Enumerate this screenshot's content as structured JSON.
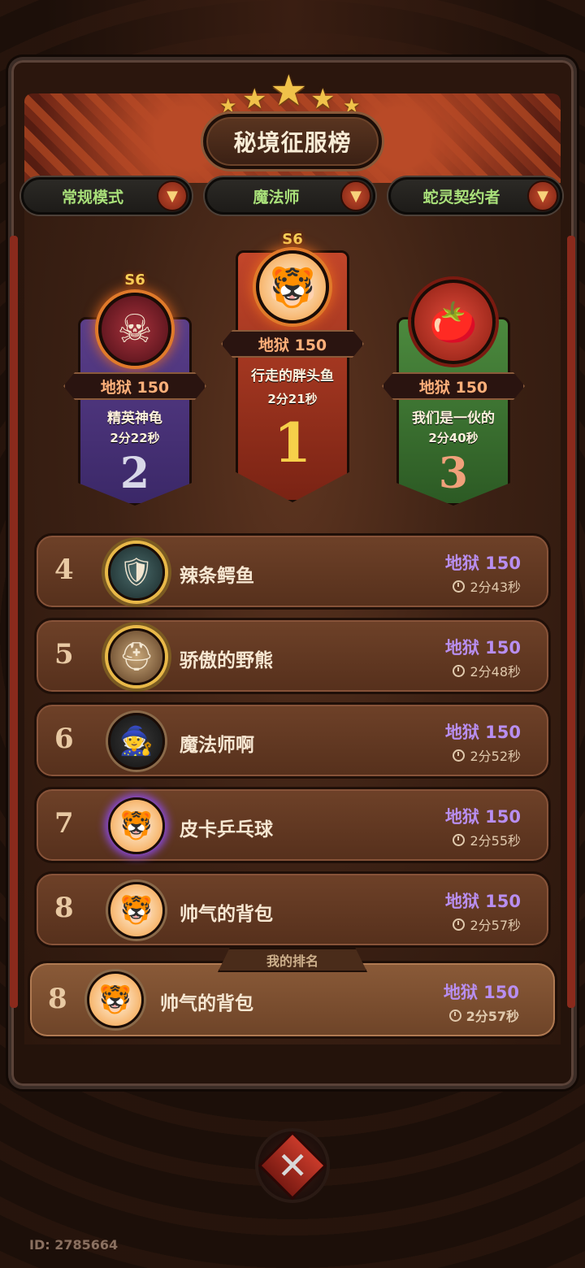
{
  "title": "秘境征服榜",
  "filters": [
    {
      "label": "常规模式"
    },
    {
      "label": "魔法师"
    },
    {
      "label": "蛇灵契约者"
    }
  ],
  "podium": [
    {
      "rank": "2",
      "season": "S6",
      "difficulty": "地狱 150",
      "name": "精英神龟",
      "time": "2分22秒",
      "avatar_icon": "demon-avatar-icon",
      "card_color": "#5a3e8a"
    },
    {
      "rank": "1",
      "season": "S6",
      "difficulty": "地狱 150",
      "name": "行走的胖头鱼",
      "time": "2分21秒",
      "avatar_icon": "tiger-avatar-icon",
      "card_color": "#c2462a"
    },
    {
      "rank": "3",
      "season": "",
      "difficulty": "地狱 150",
      "name": "我们是一伙的",
      "time": "2分40秒",
      "avatar_icon": "tomato-tiger-avatar-icon",
      "card_color": "#4c8a3e"
    }
  ],
  "rows": [
    {
      "rank": "4",
      "name": "辣条鳄鱼",
      "difficulty": "地狱 150",
      "time": "2分43秒"
    },
    {
      "rank": "5",
      "name": "骄傲的野熊",
      "difficulty": "地狱 150",
      "time": "2分48秒"
    },
    {
      "rank": "6",
      "name": "魔法师啊",
      "difficulty": "地狱 150",
      "time": "2分52秒"
    },
    {
      "rank": "7",
      "name": "皮卡乒乓球",
      "difficulty": "地狱 150",
      "time": "2分55秒"
    },
    {
      "rank": "8",
      "name": "帅气的背包",
      "difficulty": "地狱 150",
      "time": "2分57秒"
    }
  ],
  "my_rank": {
    "tag": "我的排名",
    "rank": "8",
    "name": "帅气的背包",
    "difficulty": "地狱 150",
    "time": "2分57秒"
  },
  "footer": {
    "user_id": "ID: 2785664"
  },
  "colors": {
    "difficulty": "#b88ef0",
    "filter_text": "#a9e07a",
    "accent_red": "#c2462a"
  }
}
